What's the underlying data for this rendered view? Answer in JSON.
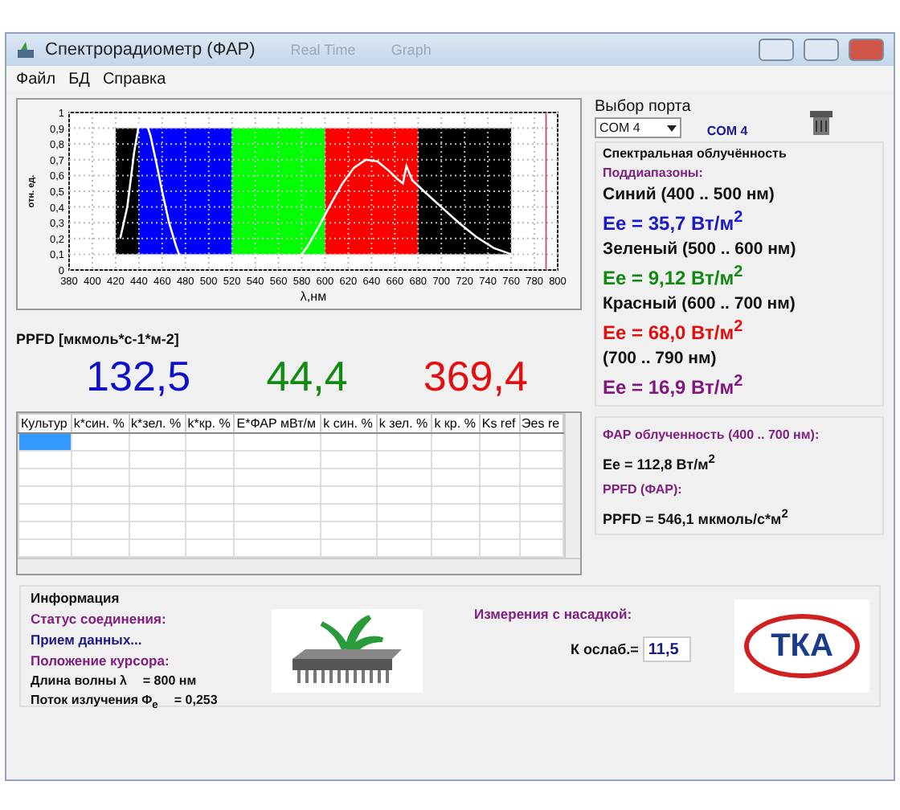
{
  "window": {
    "title": "Спектрорадиометр (ФАР)",
    "tabs": [
      "Real Time",
      "Graph"
    ]
  },
  "menu": [
    "Файл",
    "БД",
    "Справка"
  ],
  "spectrum": {
    "chart_data": {
      "type": "line",
      "xlabel": "λ,нм",
      "ylabel": "отн. ед.",
      "xlim": [
        380,
        800
      ],
      "ylim": [
        0,
        1
      ],
      "xticks": [
        380,
        400,
        420,
        440,
        460,
        480,
        500,
        520,
        540,
        560,
        580,
        600,
        620,
        640,
        660,
        680,
        700,
        720,
        740,
        760,
        780,
        800
      ],
      "yticks": [
        0,
        {
          "value": 0.1,
          "label": "0,1"
        },
        {
          "value": 0.2,
          "label": "0,2"
        },
        {
          "value": 0.3,
          "label": "0,3"
        },
        {
          "value": 0.4,
          "label": "0,4"
        },
        {
          "value": 0.5,
          "label": "0,5"
        },
        {
          "value": 0.6,
          "label": "0,6"
        },
        {
          "value": 0.7,
          "label": "0,7"
        },
        {
          "value": 0.8,
          "label": "0,8"
        },
        {
          "value": 0.9,
          "label": "0,9"
        },
        1
      ],
      "grid": true,
      "x": [
        424,
        430,
        436,
        440,
        445,
        450,
        455,
        460,
        466,
        472,
        477,
        520,
        575,
        585,
        595,
        605,
        615,
        625,
        635,
        645,
        655,
        662,
        667,
        670,
        675,
        685,
        700,
        715,
        730,
        745,
        760
      ],
      "series": [
        {
          "color": "#ffffff",
          "values": [
            0.2,
            0.4,
            0.75,
            0.92,
            0.97,
            0.85,
            0.68,
            0.5,
            0.3,
            0.15,
            0.05,
            null,
            0.05,
            0.15,
            0.28,
            0.42,
            0.55,
            0.65,
            0.7,
            0.69,
            0.63,
            0.58,
            0.55,
            0.66,
            0.57,
            0.5,
            0.4,
            0.3,
            0.21,
            0.14,
            0.1
          ]
        }
      ],
      "ref_lines": [
        {
          "axis": "x",
          "value": 790,
          "color": "#c06060"
        }
      ]
    }
  },
  "ppfd": {
    "title": "PPFD [мкмоль*с-1*м-2]",
    "values": [
      {
        "value": "132,5",
        "color": "#1010c8"
      },
      {
        "value": "44,4",
        "color": "#128a12"
      },
      {
        "value": "369,4",
        "color": "#e01010"
      }
    ]
  },
  "table": {
    "columns": [
      "Культур",
      "k*син. %",
      "k*зел. %",
      "k*кр. %",
      "E*ФАР мВт/м",
      "k син. %",
      "k зел. %",
      "k кр. %",
      "Ks ref",
      "Эes re"
    ],
    "selected_cell": true
  },
  "port": {
    "label": "Выбор порта",
    "value": "COM 4",
    "status": "COM  4"
  },
  "spectral": {
    "title": "Спектральная облучённость",
    "subtitle": "Поддиапазоны:",
    "bands": [
      {
        "label": "Синий (400 .. 500 нм)",
        "value": "Ee = 35,7  Вт/м$^{2}$",
        "color": "#1a1ac8"
      },
      {
        "label": "Зеленый (500 .. 600 нм)",
        "value": "Ee = 9,12 Вт/м$^{2}$",
        "color": "#128a12"
      },
      {
        "label": "Красный (600 .. 700 нм)",
        "value": "Ee = 68,0  Вт/м$^{2}$",
        "color": "#e01010"
      },
      {
        "label": "(700 .. 790 нм)",
        "value": "Ee = 16,9  Вт/м$^{2}$",
        "color": "#801880"
      }
    ]
  },
  "far": {
    "title": "ФАР облученность (400 .. 700 нм):",
    "value": "Ee = 112,8  Вт/м$^{2}$",
    "ppfd_title": "PPFD (ФАР):",
    "ppfd_value": "PPFD = 546,1 мкмоль/с*м$^{2}$"
  },
  "info": {
    "title": "Информация",
    "status_label": "Статус соединения:",
    "status": "Прием данных...",
    "cursor_label": "Положение курсора:",
    "wavelength_label": "Длина волны",
    "wavelength_symbol": "λ",
    "wavelength": "= 800 нм",
    "flux_label": "Поток излучения",
    "flux_symbol": "Φ$_{e}$",
    "flux": "= 0,253"
  },
  "attachment": {
    "title": "Измерения с насадкой:",
    "coef_label": "К ослаб.=",
    "coef": "11,5"
  },
  "logo": {
    "text": "ТКА"
  }
}
